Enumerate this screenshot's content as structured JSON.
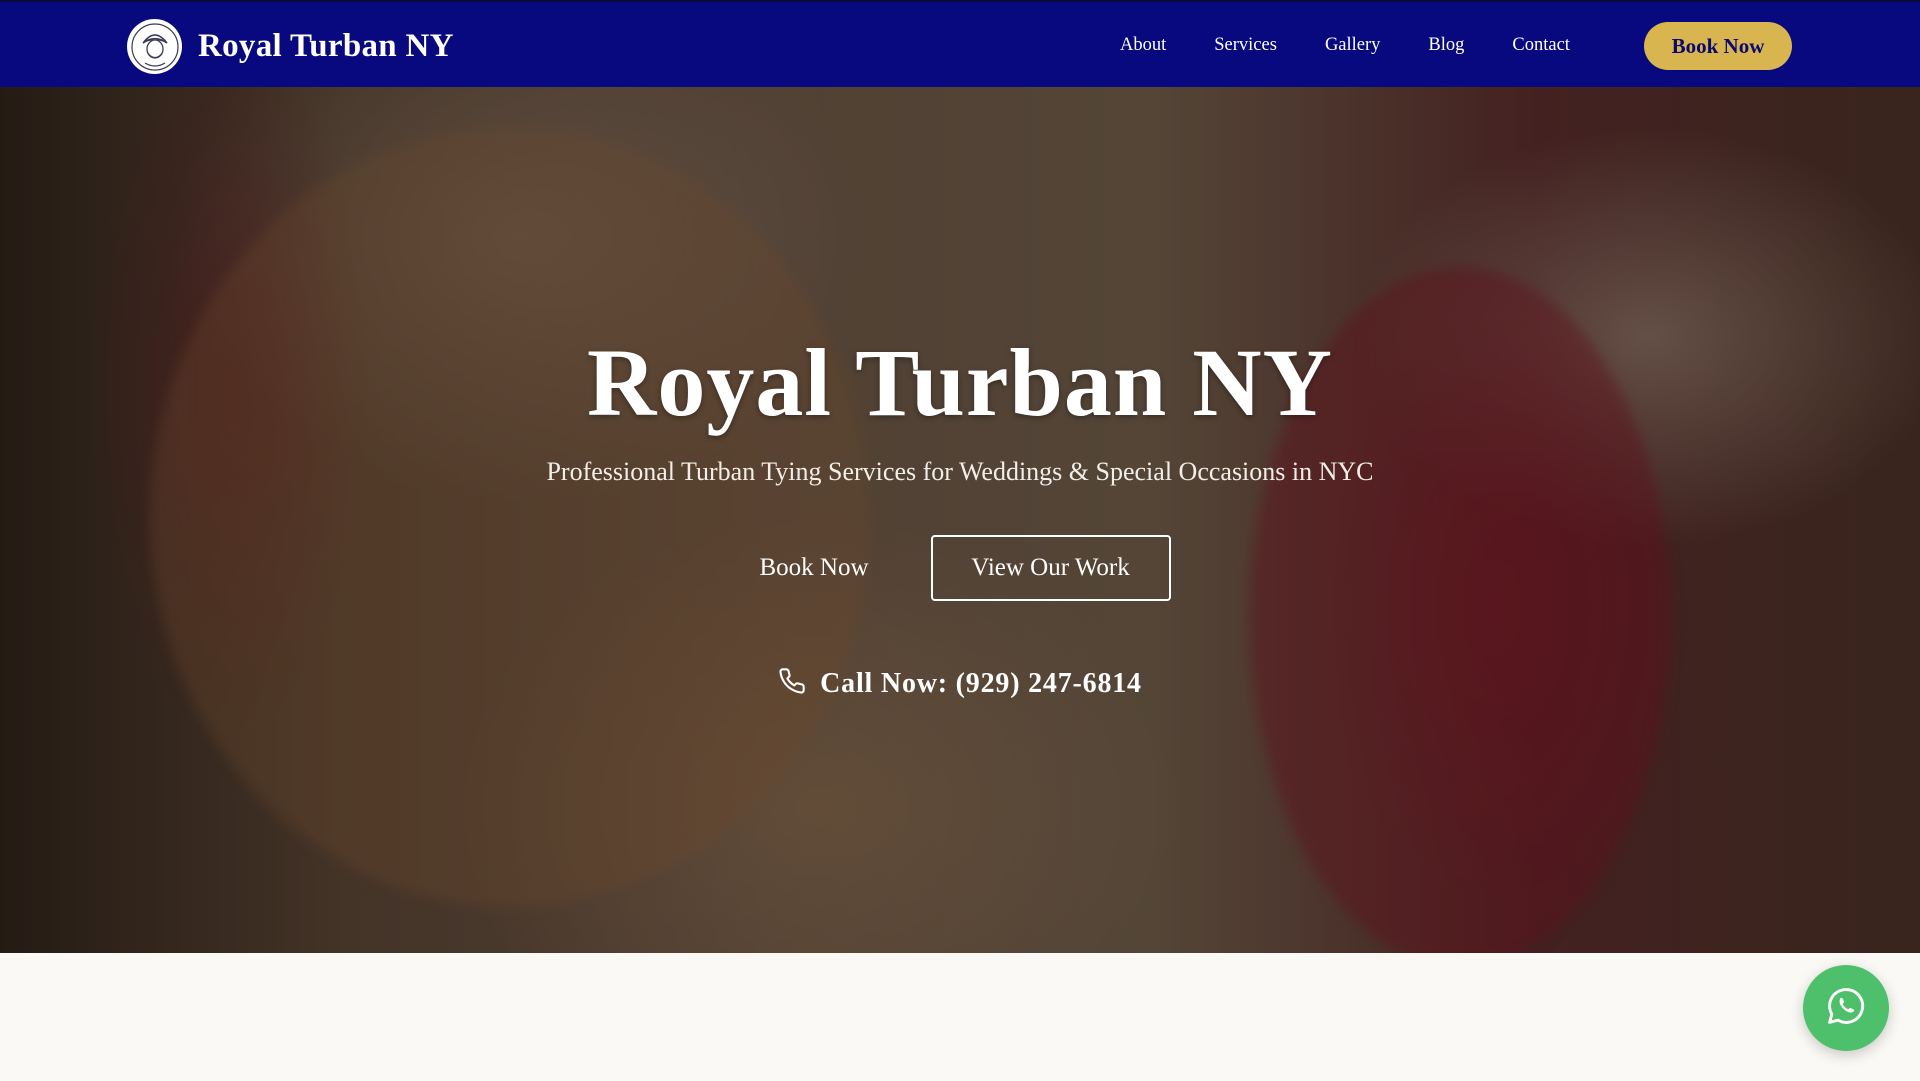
{
  "brand": {
    "name": "Royal Turban NY",
    "logo_icon": "turban-man-icon"
  },
  "nav": {
    "links": [
      "About",
      "Services",
      "Gallery",
      "Blog",
      "Contact"
    ],
    "cta_label": "Book Now"
  },
  "hero": {
    "title": "Royal Turban NY",
    "subtitle": "Professional Turban Tying Services for Weddings & Special Occasions in NYC",
    "primary_button": "Book Now",
    "secondary_button": "View Our Work",
    "call_text": "Call Now: (929) 247-6814",
    "call_icon": "phone-icon"
  },
  "floating": {
    "whatsapp_icon": "whatsapp-icon"
  },
  "colors": {
    "nav_bg": "#08087f",
    "accent_gold": "#d8b54e",
    "whatsapp_green": "#4ec06b",
    "page_bg": "#faf9f6"
  }
}
